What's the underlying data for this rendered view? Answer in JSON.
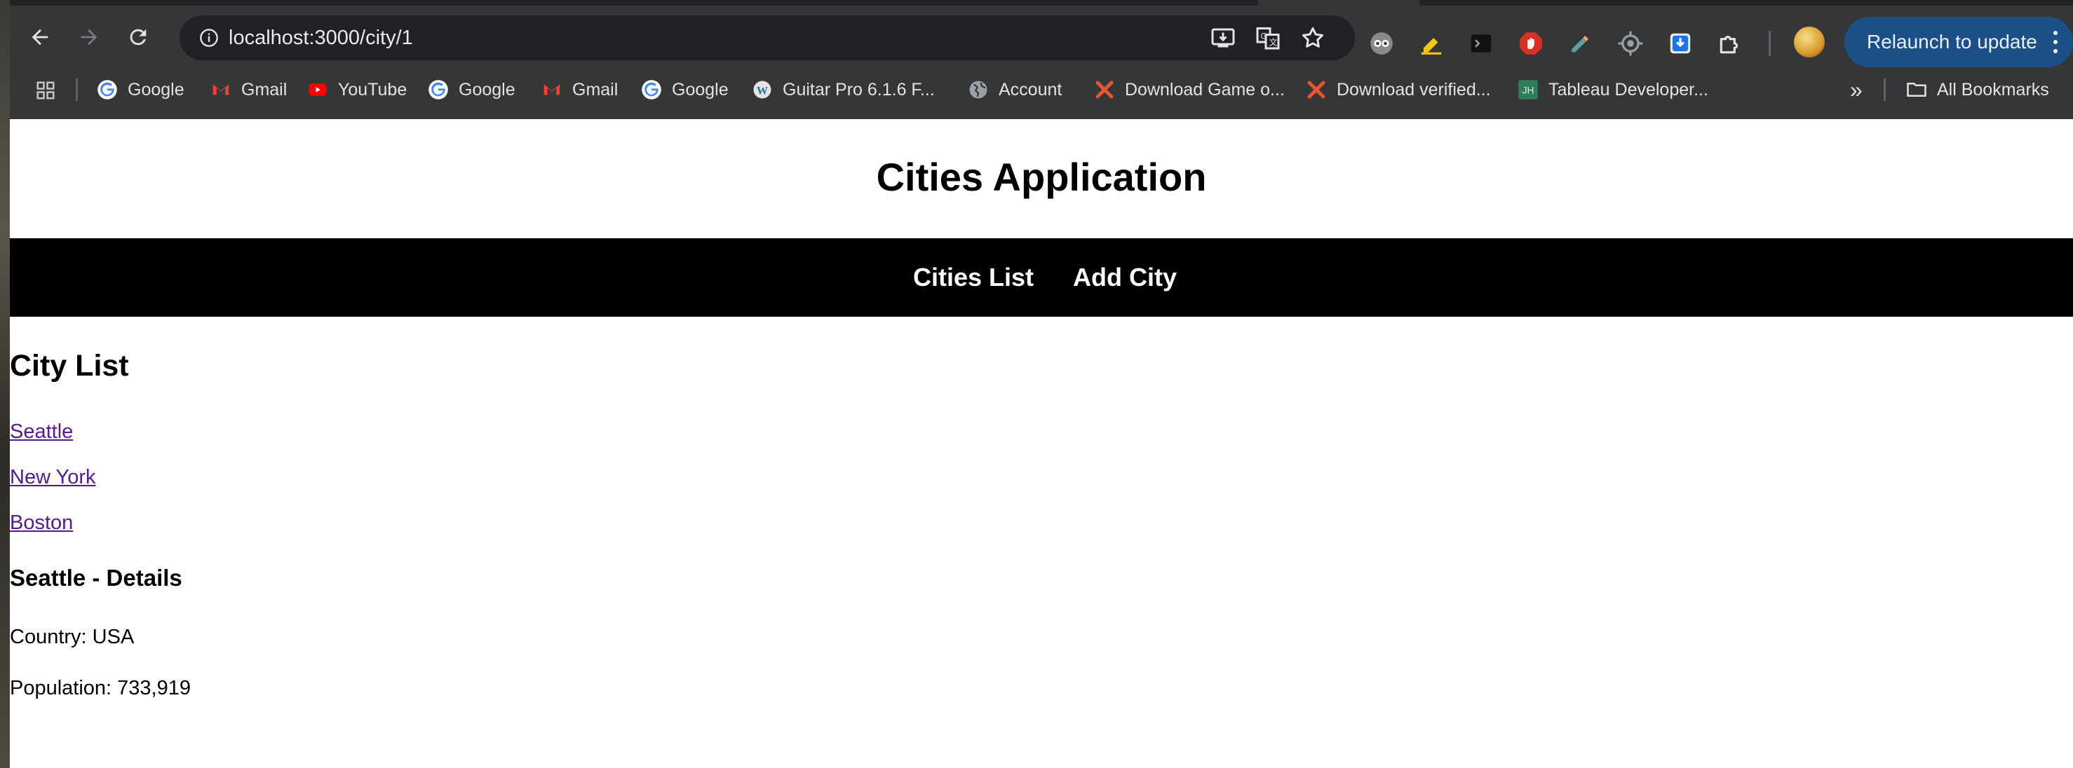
{
  "browser": {
    "url": "localhost:3000/city/1",
    "relaunch_label": "Relaunch to update",
    "bookmarks": [
      {
        "label": "Google",
        "icon": "google-icon"
      },
      {
        "label": "Gmail",
        "icon": "gmail-icon"
      },
      {
        "label": "YouTube",
        "icon": "youtube-icon"
      },
      {
        "label": "Google",
        "icon": "google-icon"
      },
      {
        "label": "Gmail",
        "icon": "gmail-icon"
      },
      {
        "label": "Google",
        "icon": "google-icon"
      },
      {
        "label": "Guitar Pro 6.1.6 F...",
        "icon": "wordpress-icon"
      },
      {
        "label": "Account",
        "icon": "globe-icon"
      },
      {
        "label": "Download Game o...",
        "icon": "x-logo-icon"
      },
      {
        "label": "Download verified...",
        "icon": "x-logo-icon"
      },
      {
        "label": "Tableau Developer...",
        "icon": "jh-icon"
      }
    ],
    "all_bookmarks_label": "All Bookmarks",
    "more_bookmarks_glyph": "»"
  },
  "app": {
    "title": "Cities Application",
    "nav": {
      "cities_list": "Cities List",
      "add_city": "Add City"
    },
    "city_list_heading": "City List",
    "cities": [
      "Seattle",
      "New York",
      "Boston"
    ],
    "details": {
      "heading": "Seattle - Details",
      "country": "Country: USA",
      "population": "Population: 733,919"
    }
  },
  "colors": {
    "chrome_bg": "#353638",
    "omnibox_bg": "#202124",
    "relaunch_bg": "#1c4f86",
    "navbar_bg": "#000000",
    "visited_link": "#551a8b"
  }
}
